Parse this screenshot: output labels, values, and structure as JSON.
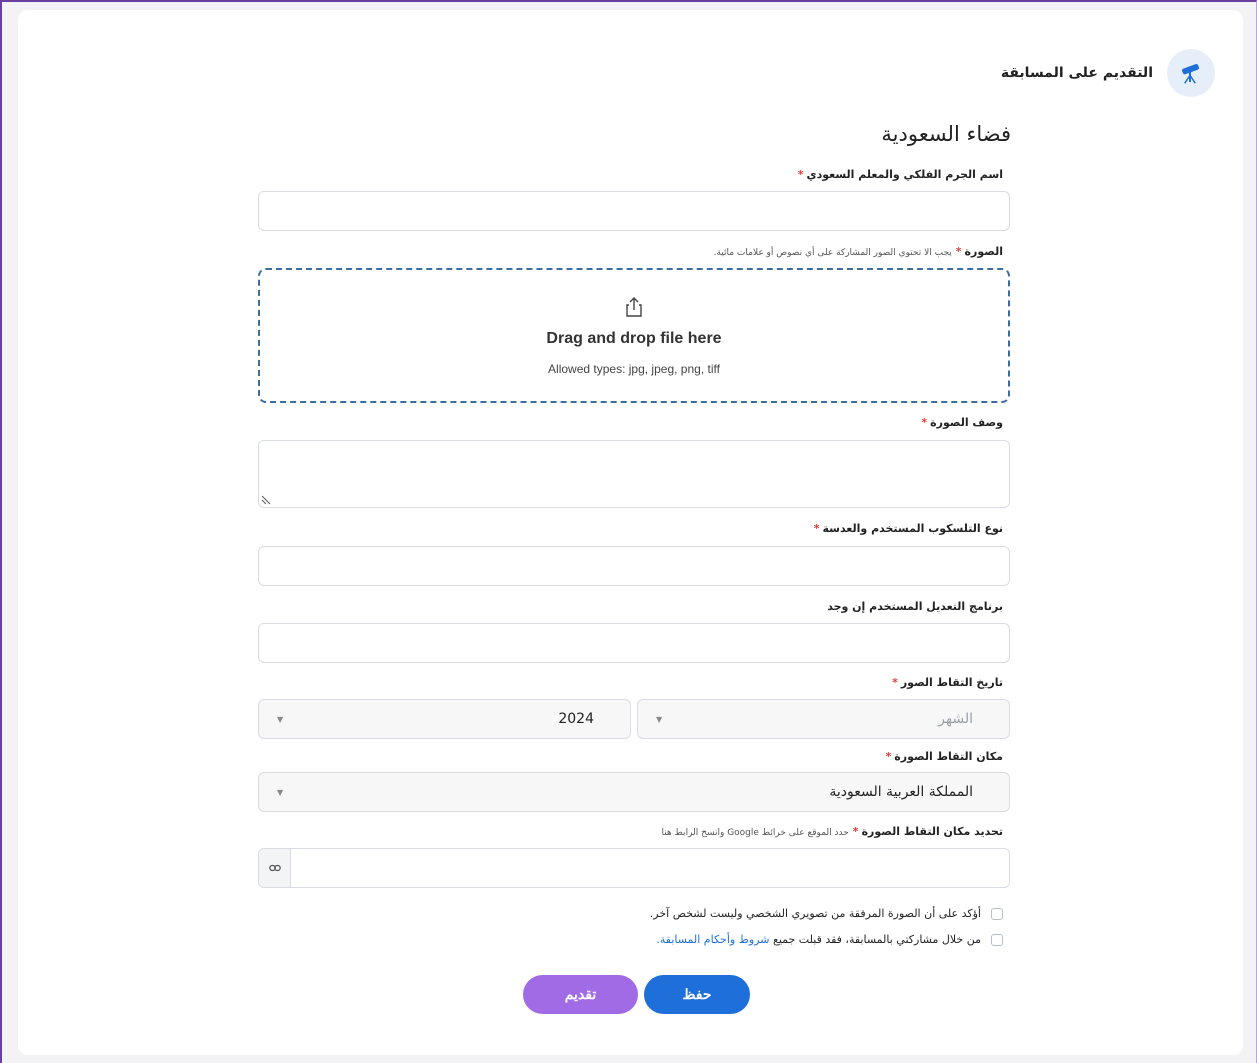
{
  "header": {
    "title": "التقديم على المسابقة",
    "icon": "telescope-icon"
  },
  "form": {
    "title": "فضاء السعودية",
    "fields": {
      "object_name": {
        "label": "اسم الجرم الفلكي والمعلم السعودي",
        "required_mark": "*",
        "value": ""
      },
      "image": {
        "label": "الصورة",
        "required_mark": "*",
        "hint": "يجب الا تحتوي الصور المشاركة على أي نصوص أو علامات مائية.",
        "dropzone_title": "Drag and drop file here",
        "allowed_types": "Allowed types: jpg, jpeg, png, tiff"
      },
      "description": {
        "label": "وصف الصورة",
        "required_mark": "*",
        "value": ""
      },
      "telescope": {
        "label": "نوع التلسكوب المستخدم والعدسة",
        "required_mark": "*",
        "value": ""
      },
      "software": {
        "label": "برنامج التعديل المستخدم إن وجد",
        "value": ""
      },
      "capture_date": {
        "label": "تاريخ التقاط الصور",
        "required_mark": "*",
        "month_placeholder": "الشهر",
        "year_value": "2024"
      },
      "capture_place": {
        "label": "مكان التقاط الصورة",
        "required_mark": "*",
        "value": "المملكة العربية السعودية"
      },
      "location_link": {
        "label": "تحديد مكان التقاط الصورة",
        "required_mark": "*",
        "hint": "حدد الموقع على خرائط Google وانسخ الرابط هنا",
        "value": ""
      }
    },
    "checks": {
      "ownership": "أؤكد على أن الصورة المرفقة من تصويري الشخصي وليست لشخص آخر.",
      "terms_prefix": "من خلال مشاركتي بالمسابقة، فقد قبلت جميع ",
      "terms_link": "شروط وأحكام المسابقة."
    },
    "buttons": {
      "save": "حفظ",
      "submit": "تقديم"
    }
  },
  "colors": {
    "primary": "#1e6fd9",
    "submit": "#a26be6",
    "required": "#e53935",
    "dropzone_border": "#3a6ea0"
  }
}
